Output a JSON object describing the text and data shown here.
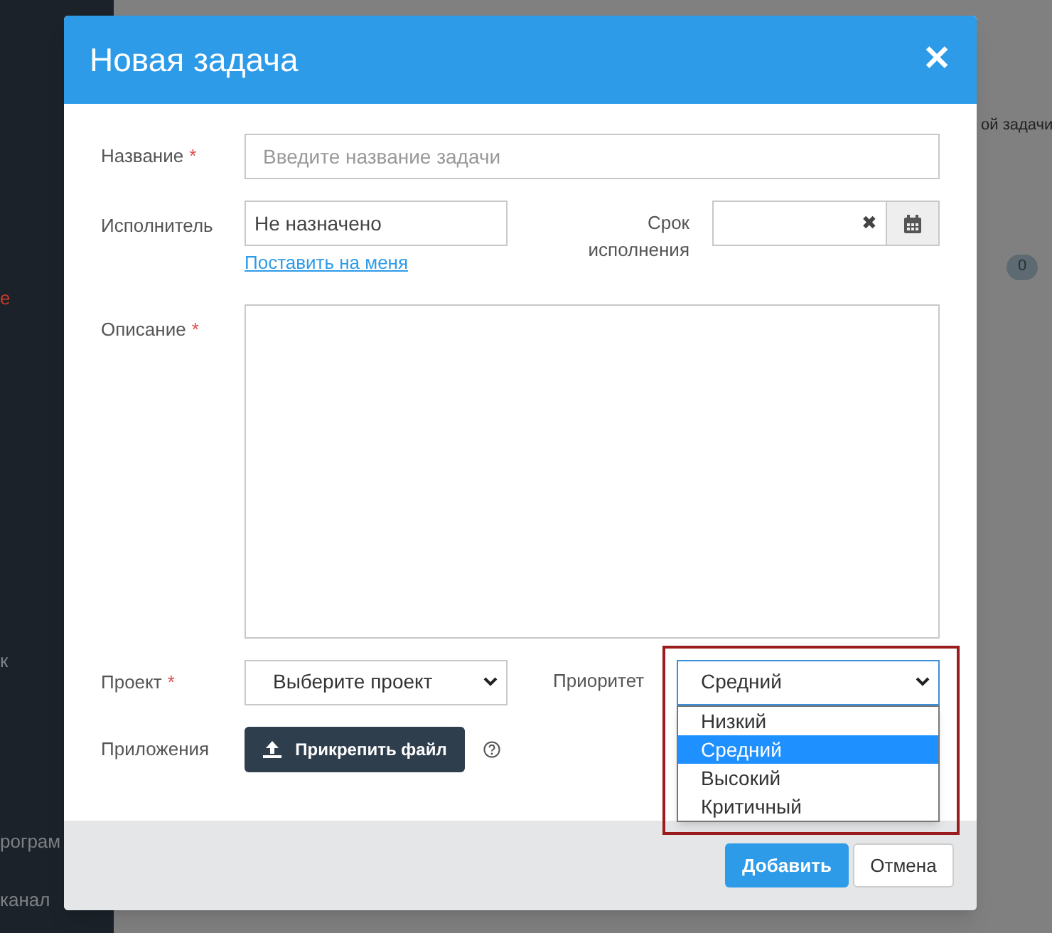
{
  "background": {
    "sidebar_fragments": [
      {
        "text": "е",
        "selected": true
      },
      {
        "text": "к",
        "selected": false
      },
      {
        "text": "рограм",
        "selected": false
      },
      {
        "text": "канал",
        "selected": false
      }
    ],
    "panel_fragment": "ой задачи",
    "counter": "0"
  },
  "dialog": {
    "title": "Новая задача",
    "close_icon": "✕",
    "fields": {
      "name": {
        "label": "Название",
        "required_mark": "*",
        "placeholder": "Введите название задачи"
      },
      "assignee": {
        "label": "Исполнитель",
        "value": "Не назначено",
        "link": "Поставить на меня"
      },
      "deadline": {
        "label": "Срок исполнения",
        "clear_icon": "✖"
      },
      "description": {
        "label": "Описание",
        "required_mark": "*"
      },
      "project": {
        "label": "Проект",
        "required_mark": "*",
        "value": "Выберите проект"
      },
      "priority": {
        "label": "Приоритет",
        "value": "Средний",
        "expanded": true,
        "highlighted": true,
        "options": [
          {
            "label": "Низкий",
            "selected": false
          },
          {
            "label": "Средний",
            "selected": true
          },
          {
            "label": "Высокий",
            "selected": false
          },
          {
            "label": "Критичный",
            "selected": false
          }
        ]
      },
      "attachments": {
        "label": "Приложения",
        "button": "Прикрепить файл"
      }
    },
    "buttons": [
      {
        "label": "Добавить",
        "kind": "primary"
      },
      {
        "label": "Отмена",
        "kind": "secondary"
      }
    ]
  }
}
